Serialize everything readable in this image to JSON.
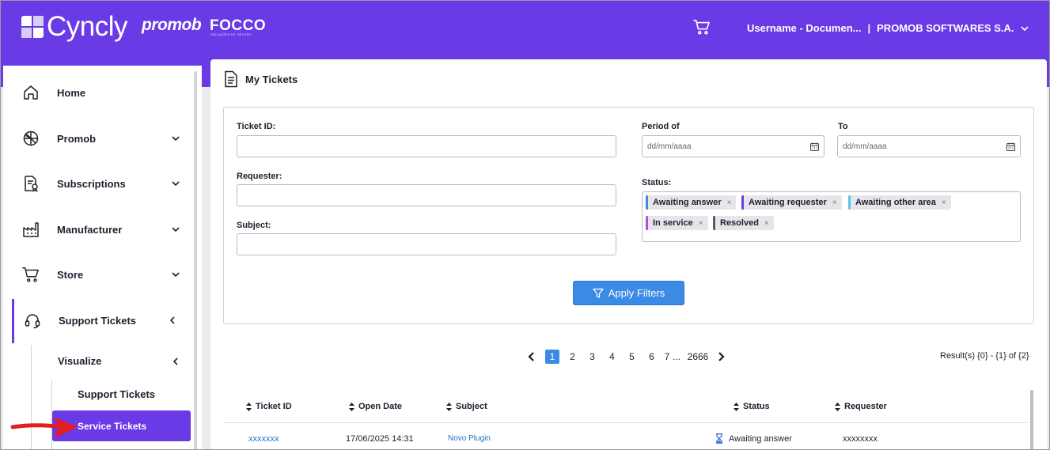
{
  "header": {
    "logo_text": "Cyncly",
    "brand_promob": "promob",
    "brand_focco": "FOCCO",
    "brand_focco_sub": "SOLUÇÕES DE GESTÃO",
    "user": "Username - Documen...",
    "separator": "|",
    "company": "PROMOB SOFTWARES S.A."
  },
  "sidebar": {
    "items": [
      {
        "label": "Home",
        "icon": "home-icon"
      },
      {
        "label": "Promob",
        "icon": "promob-icon"
      },
      {
        "label": "Subscriptions",
        "icon": "subscriptions-icon"
      },
      {
        "label": "Manufacturer",
        "icon": "factory-icon"
      },
      {
        "label": "Store",
        "icon": "cart-icon"
      },
      {
        "label": "Support Tickets",
        "icon": "headset-icon"
      }
    ],
    "visualize": "Visualize",
    "support_tickets_sub": "Support Tickets",
    "service_tickets": "Service Tickets"
  },
  "main": {
    "title": "My Tickets",
    "filters": {
      "ticket_id_label": "Ticket ID:",
      "requester_label": "Requester:",
      "subject_label": "Subject:",
      "period_label": "Period of",
      "to_label": "To",
      "period_placeholder": "dd/mm/aaaa",
      "to_placeholder": "dd/mm/aaaa",
      "status_label": "Status:",
      "status_chips": [
        {
          "label": "Awaiting answer",
          "color": "#3b8ae6"
        },
        {
          "label": "Awaiting requester",
          "color": "#6a3ae6"
        },
        {
          "label": "Awaiting other area",
          "color": "#5fc3ea"
        },
        {
          "label": "In service",
          "color": "#b34de0"
        },
        {
          "label": "Resolved",
          "color": "#555b66"
        }
      ],
      "chip_remove": "×",
      "apply_label": "Apply Filters"
    },
    "pagination": {
      "pages": [
        "1",
        "2",
        "3",
        "4",
        "5",
        "6",
        "7"
      ],
      "ellipsis": "...",
      "last": "2666",
      "results": "Result(s) {0} - {1} of {2}"
    },
    "table": {
      "headers": [
        "Ticket ID",
        "Open Date",
        "Subject",
        "Status",
        "Requester"
      ],
      "rows": [
        {
          "ticket_id": "xxxxxxx",
          "open_date": "17/06/2025 14:31",
          "subject": "Novo Plugin",
          "status": "Awaiting answer",
          "requester": "xxxxxxxx"
        }
      ]
    }
  },
  "colors": {
    "brand": "#6a3ae6",
    "accent": "#3b8ae6",
    "arrow": "#e41e1e"
  }
}
